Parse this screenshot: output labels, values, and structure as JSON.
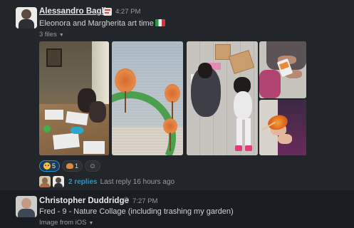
{
  "messages": [
    {
      "author": "Alessandro Baglio",
      "time": "4:27 PM",
      "text": "Eleonora and Margherita art time",
      "files_label": "3 files",
      "reactions": [
        {
          "emoji": "heart-eyes-emoji",
          "count": "5",
          "active": true
        },
        {
          "emoji": "snail-emoji",
          "count": "1",
          "active": false
        }
      ],
      "thread": {
        "replies": "2 replies",
        "last_reply": "Last reply 16 hours ago"
      }
    },
    {
      "author": "Christopher Duddridge",
      "time": "7:27 PM",
      "text": "Fred - 9 - Nature Collage (including trashing my garden)",
      "files_label": "Image from iOS"
    }
  ],
  "colors": {
    "background": "#1a1d21",
    "hover_background": "#222529",
    "link": "#1d9bd1",
    "active_reaction": "#1d3a57"
  }
}
